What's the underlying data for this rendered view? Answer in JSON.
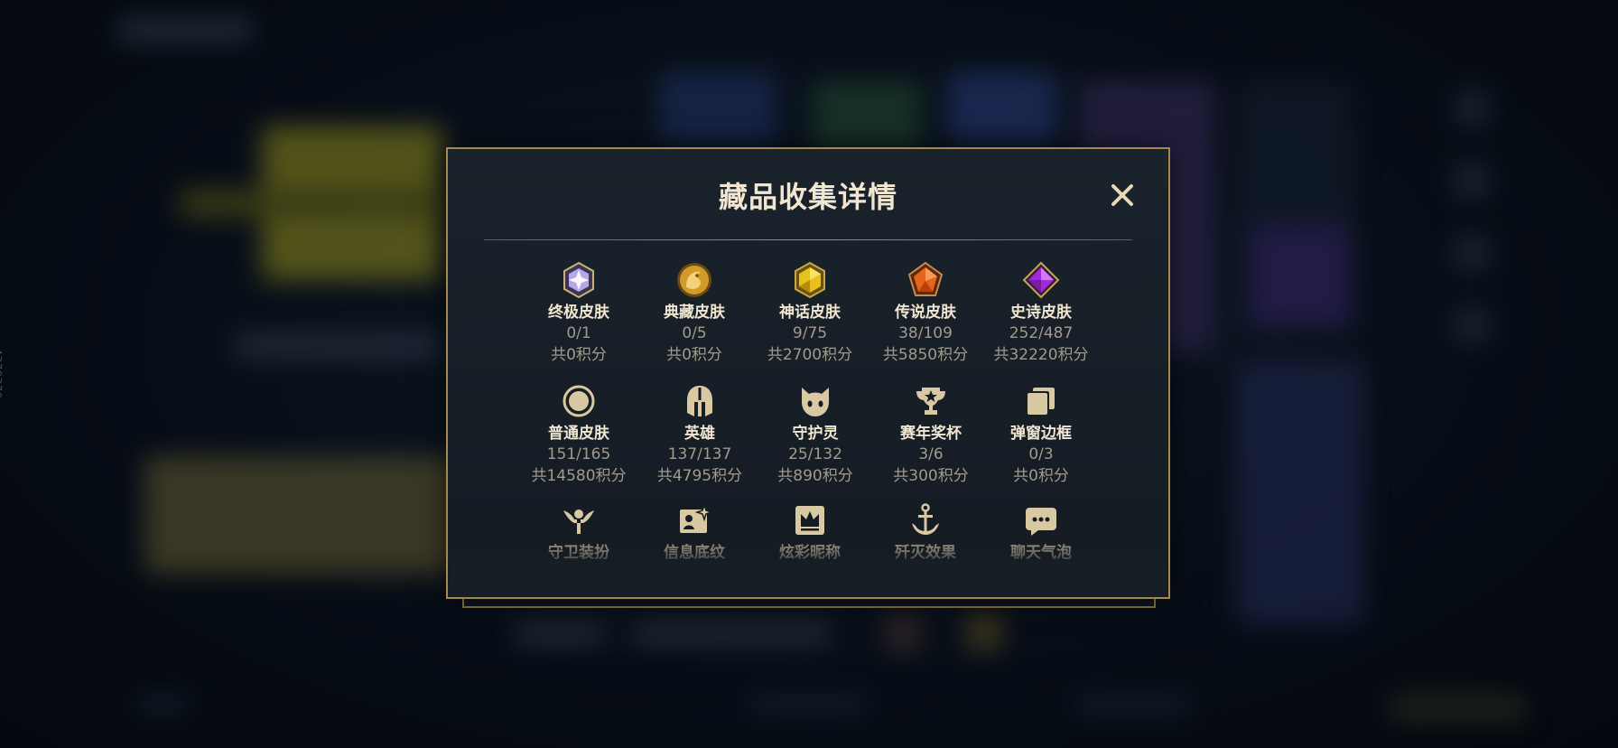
{
  "background": {
    "side_id": "4379370"
  },
  "modal": {
    "title": "藏品收集详情",
    "close_label": "✕",
    "accent_color": "#a3884f",
    "rows": [
      [
        {
          "icon": "ultimate-skin-icon",
          "label": "终极皮肤",
          "count": "0/1",
          "points": "共0积分"
        },
        {
          "icon": "prestige-skin-icon",
          "label": "典藏皮肤",
          "count": "0/5",
          "points": "共0积分"
        },
        {
          "icon": "mythic-skin-icon",
          "label": "神话皮肤",
          "count": "9/75",
          "points": "共2700积分"
        },
        {
          "icon": "legendary-skin-icon",
          "label": "传说皮肤",
          "count": "38/109",
          "points": "共5850积分"
        },
        {
          "icon": "epic-skin-icon",
          "label": "史诗皮肤",
          "count": "252/487",
          "points": "共32220积分"
        }
      ],
      [
        {
          "icon": "standard-skin-icon",
          "label": "普通皮肤",
          "count": "151/165",
          "points": "共14580积分"
        },
        {
          "icon": "champion-helmet-icon",
          "label": "英雄",
          "count": "137/137",
          "points": "共4795积分"
        },
        {
          "icon": "little-legend-icon",
          "label": "守护灵",
          "count": "25/132",
          "points": "共890积分"
        },
        {
          "icon": "trophy-icon",
          "label": "赛年奖杯",
          "count": "3/6",
          "points": "共300积分"
        },
        {
          "icon": "popup-frame-icon",
          "label": "弹窗边框",
          "count": "0/3",
          "points": "共0积分"
        }
      ],
      [
        {
          "icon": "ward-skin-icon",
          "label": "守卫装扮"
        },
        {
          "icon": "info-banner-icon",
          "label": "信息底纹"
        },
        {
          "icon": "nickname-crown-icon",
          "label": "炫彩昵称"
        },
        {
          "icon": "annihilation-effect-icon",
          "label": "歼灭效果"
        },
        {
          "icon": "chat-bubble-icon",
          "label": "聊天气泡"
        }
      ]
    ]
  }
}
